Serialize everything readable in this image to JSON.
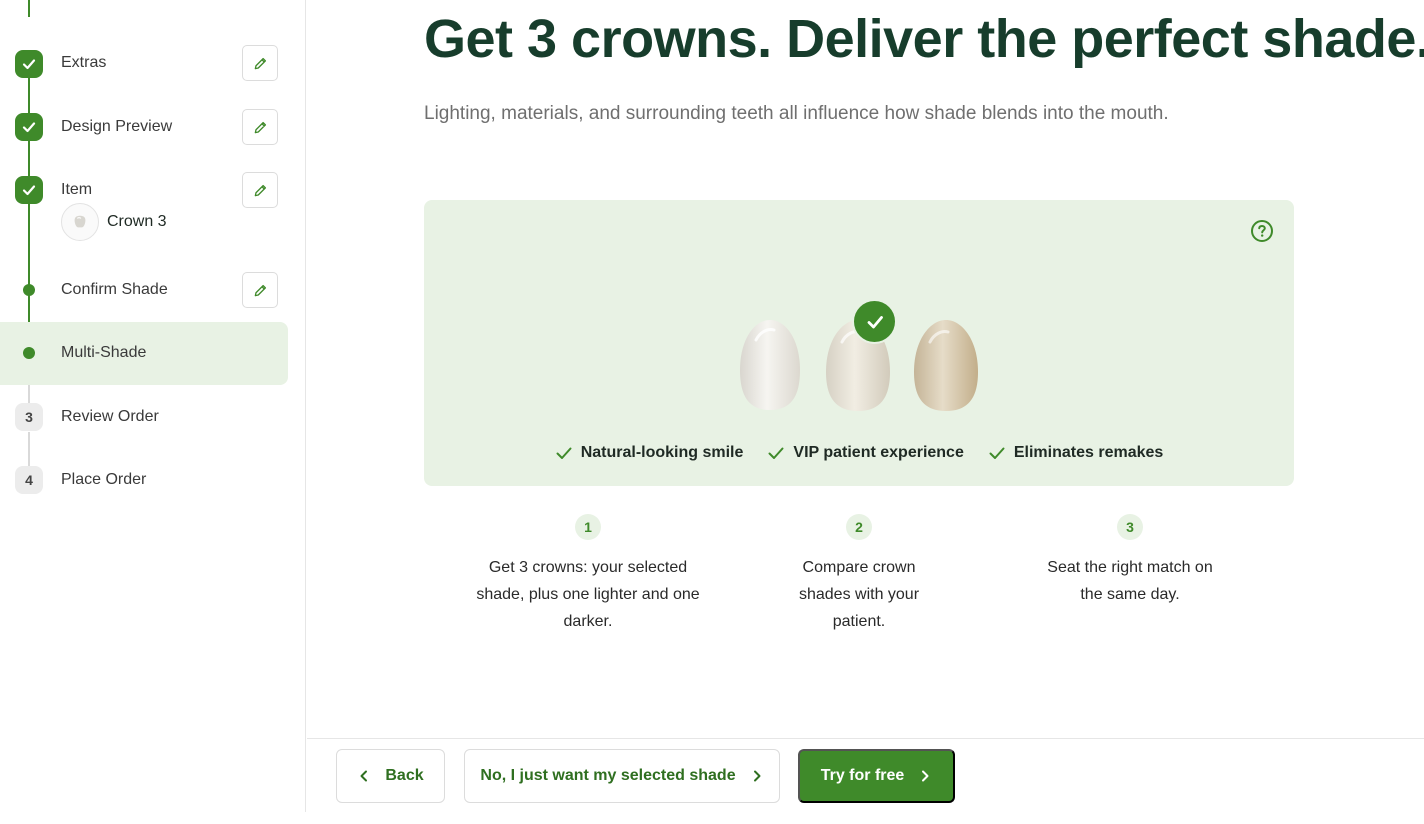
{
  "sidebar": {
    "steps": [
      {
        "label": "Extras",
        "state": "done",
        "icon": "check-icon",
        "editable": true
      },
      {
        "label": "Design Preview",
        "state": "done",
        "icon": "check-icon",
        "editable": true
      },
      {
        "label": "Item",
        "state": "done",
        "icon": "check-icon",
        "editable": true,
        "sub_label": "Crown 3"
      },
      {
        "label": "Confirm Shade",
        "state": "substep-done",
        "editable": true
      },
      {
        "label": "Multi-Shade",
        "state": "active"
      },
      {
        "label": "Review Order",
        "state": "pending",
        "number": "3"
      },
      {
        "label": "Place Order",
        "state": "pending",
        "number": "4"
      }
    ]
  },
  "main": {
    "headline": "Get 3 crowns. Deliver the perfect shade.",
    "subline": "Lighting, materials, and surrounding teeth all influence how shade blends into the mouth.",
    "benefits": [
      "Natural-looking smile",
      "VIP patient experience",
      "Eliminates remakes"
    ],
    "steps": [
      {
        "number": "1",
        "text": "Get 3 crowns: your selected shade, plus one lighter and one darker."
      },
      {
        "number": "2",
        "text": "Compare crown shades with your patient."
      },
      {
        "number": "3",
        "text": "Seat the right match on the same day."
      }
    ]
  },
  "footer": {
    "back_label": "Back",
    "decline_label": "No, I just want my selected shade",
    "accept_label": "Try for free"
  },
  "colors": {
    "brand_green": "#3f8a2a",
    "headline": "#173d2c",
    "promo_bg": "#e8f2e4"
  }
}
